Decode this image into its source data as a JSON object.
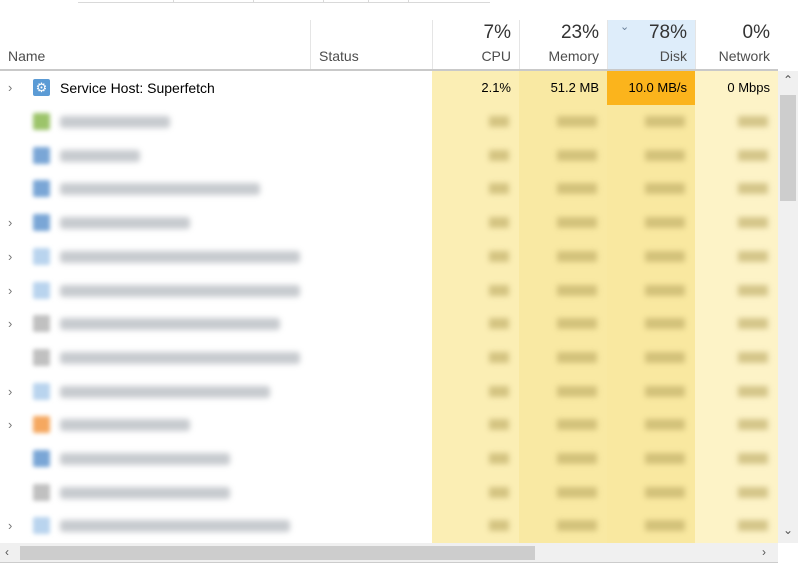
{
  "header": {
    "name": "Name",
    "status": "Status",
    "cpu": {
      "percent": "7%",
      "label": "CPU"
    },
    "memory": {
      "percent": "23%",
      "label": "Memory"
    },
    "disk": {
      "percent": "78%",
      "label": "Disk",
      "sorted": true
    },
    "network": {
      "percent": "0%",
      "label": "Network"
    }
  },
  "rows": [
    {
      "name": "Service Host: Superfetch",
      "expandable": true,
      "icon": "gear-icon",
      "cpu": "2.1%",
      "memory": "51.2 MB",
      "disk": "10.0 MB/s",
      "network": "0 Mbps",
      "blurred": false
    }
  ],
  "blurred_rows": [
    {
      "expandable": false,
      "icon_color": "#9cc46a"
    },
    {
      "expandable": false,
      "icon_color": "#7aa6d6"
    },
    {
      "expandable": false,
      "icon_color": "#7aa6d6"
    },
    {
      "expandable": true,
      "icon_color": "#7aa6d6"
    },
    {
      "expandable": true,
      "icon_color": "#b9d4ee"
    },
    {
      "expandable": true,
      "icon_color": "#b9d4ee"
    },
    {
      "expandable": true,
      "icon_color": "#c0c0c0"
    },
    {
      "expandable": false,
      "icon_color": "#c0c0c0"
    },
    {
      "expandable": true,
      "icon_color": "#b9d4ee"
    },
    {
      "expandable": true,
      "icon_color": "#f5a860"
    },
    {
      "expandable": false,
      "icon_color": "#7aa6d6"
    },
    {
      "expandable": false,
      "icon_color": "#c0c0c0"
    },
    {
      "expandable": true,
      "icon_color": "#b9d4ee"
    }
  ],
  "colors": {
    "disk_highlight": "#fbb41c",
    "sorted_header": "#deedfa"
  }
}
